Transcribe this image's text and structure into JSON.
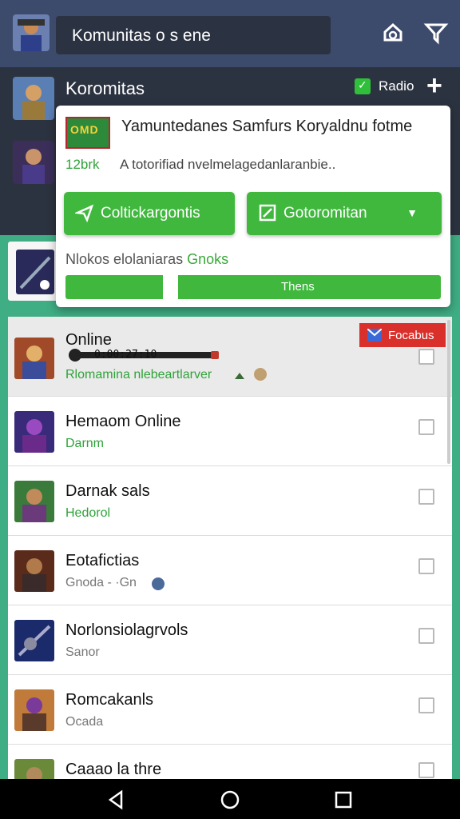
{
  "topbar": {
    "search_text": "Komunitas o s ene",
    "icons": [
      "avatar",
      "notification-icon",
      "filter-icon"
    ]
  },
  "band": {
    "title": "Koromitas",
    "badge_label": "Radio",
    "plus_icon": "plus-icon"
  },
  "popup": {
    "logo_text": "OMD",
    "heading": "Yamuntedanes Samfurs Koryaldnu fotme",
    "size": "12brk",
    "description": "A totorifiad nvelmelagedanlaranbie..",
    "button_primary": "Coltickargontis",
    "button_secondary": "Gotoromitan",
    "download_label": "Nlokos elolaniaras",
    "download_label_em": "Gnoks",
    "progress_label": "Thens",
    "progress": 0.3
  },
  "list": {
    "selected": {
      "name": "Online",
      "time": "0:00:27:10",
      "subtitle": "Rlomamina nlebeartlarver",
      "favorite_label": "Focabus"
    },
    "items": [
      {
        "name": "Hemaom Online",
        "subtitle": "Darnm",
        "subtitle_color": "#2fa33a"
      },
      {
        "name": "Darnak sals",
        "subtitle": "Hedorol",
        "subtitle_color": "#2fa33a"
      },
      {
        "name": "Eotafictias",
        "subtitle": "Gnoda - ·Gn",
        "subtitle_color": "#777777"
      },
      {
        "name": "Norlonsiolagrvols",
        "subtitle": "Sanor",
        "subtitle_color": "#777777"
      },
      {
        "name": "Romcakanls",
        "subtitle": "Ocada",
        "subtitle_color": "#777777"
      },
      {
        "name": "Caaao la thre",
        "subtitle": "",
        "subtitle_color": "#777777"
      }
    ]
  },
  "colors": {
    "green": "#3fb83d",
    "accent_red": "#d9302b",
    "topbar": "#3c4a6b"
  }
}
